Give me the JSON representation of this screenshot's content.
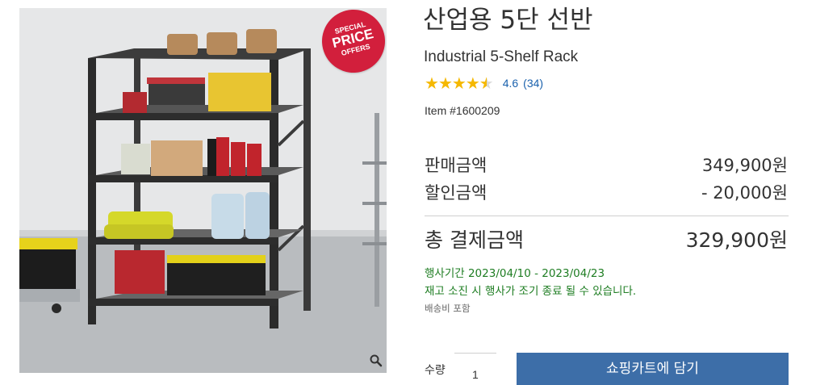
{
  "badge": {
    "line1": "SPECIAL",
    "line2": "PRICE",
    "line3": "OFFERS"
  },
  "product": {
    "title_ko": "산업용 5단 선반",
    "title_en": "Industrial 5-Shelf Rack",
    "rating_value": "4.6",
    "rating_count": "(34)",
    "rating_stars": 4.6,
    "item_number": "Item #1600209"
  },
  "pricing": {
    "sale_label": "판매금액",
    "sale_price": "349,900원",
    "discount_label": "할인금액",
    "discount_amount": "- 20,000원",
    "total_label": "총 결제금액",
    "total_price": "329,900원",
    "promo_period": "행사기간 2023/04/10 - 2023/04/23",
    "stock_notice": "재고 소진 시 행사가 조기 종료 될 수 있습니다.",
    "shipping_note": "배송비 포함"
  },
  "purchase": {
    "qty_label": "수량",
    "qty_value": "1",
    "add_to_cart": "쇼핑카트에 담기"
  },
  "colors": {
    "accent": "#3d6ea8",
    "badge": "#d21f3c",
    "promo_text": "#1e7d22",
    "star": "#f5b800",
    "link": "#1a61ad"
  },
  "icons": {
    "zoom": "magnifier-icon",
    "star": "star-icon"
  }
}
